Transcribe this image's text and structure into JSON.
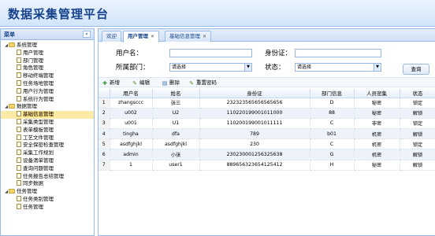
{
  "app_title": "数据采集管理平台",
  "sidebar": {
    "title": "菜单",
    "collapse_glyph": "«",
    "groups": [
      {
        "label": "系统管理",
        "items": [
          "用户管理",
          "部门管理",
          "角色管理",
          "移动终端管理",
          "任务场地管理",
          "用户行为管理",
          "系统行为管理"
        ]
      },
      {
        "label": "数据管理",
        "items": [
          "基础信息管理",
          "采集类型管理",
          "表单模板管理",
          "工艺文件管理",
          "安全保密检查管理",
          "采集工作规划",
          "设备清单管理",
          "查询问题管理",
          "任务报告总结管理",
          "同步数据"
        ]
      },
      {
        "label": "任务管理",
        "items": [
          "任务类别管理",
          "任务管理"
        ]
      }
    ],
    "selected": "基础信息管理"
  },
  "tabs": [
    {
      "label": "欢迎",
      "closable": false,
      "active": false
    },
    {
      "label": "用户管理",
      "closable": true,
      "active": true
    },
    {
      "label": "基础信息管理",
      "closable": true,
      "active": false
    }
  ],
  "search": {
    "username_label": "用户名：",
    "idcard_label": "身份证：",
    "dept_label": "所属部门：",
    "dept_value": "请选择",
    "status_label": "状态：",
    "status_value": "请选择",
    "query_button": "查询"
  },
  "toolbar": {
    "add": "新增",
    "edit": "编辑",
    "delete": "删除",
    "reset_password": "重置密码"
  },
  "grid": {
    "columns": [
      "",
      "用户名",
      "姓名",
      "身份证",
      "部门信息",
      "人员密集",
      "状态"
    ],
    "rows": [
      {
        "n": "1",
        "username": "zhangsccc",
        "name": "张三",
        "idcard": "232323565656565656",
        "dept": "D",
        "secret": "秘密",
        "status": "锁定"
      },
      {
        "n": "2",
        "username": "u002",
        "name": "U2",
        "idcard": "110220199001011000",
        "dept": "88",
        "secret": "秘密",
        "status": "解锁"
      },
      {
        "n": "3",
        "username": "u001",
        "name": "U1",
        "idcard": "110200199001011111",
        "dept": "C",
        "secret": "非密",
        "status": "锁定"
      },
      {
        "n": "4",
        "username": "tingha",
        "name": "dfa",
        "idcard": "789",
        "dept": "b01",
        "secret": "机密",
        "status": "解锁"
      },
      {
        "n": "5",
        "username": "asdfghjkl",
        "name": "asdfghjkl",
        "idcard": "230",
        "dept": "C",
        "secret": "机密",
        "status": "锁定"
      },
      {
        "n": "6",
        "username": "admin",
        "name": "小张",
        "idcard": "230230001256325638",
        "dept": "G",
        "secret": "机密",
        "status": "解锁"
      },
      {
        "n": "7",
        "username": "1",
        "name": "user1",
        "idcard": "889656323654125412",
        "dept": "H",
        "secret": "秘密",
        "status": "解锁"
      }
    ]
  }
}
